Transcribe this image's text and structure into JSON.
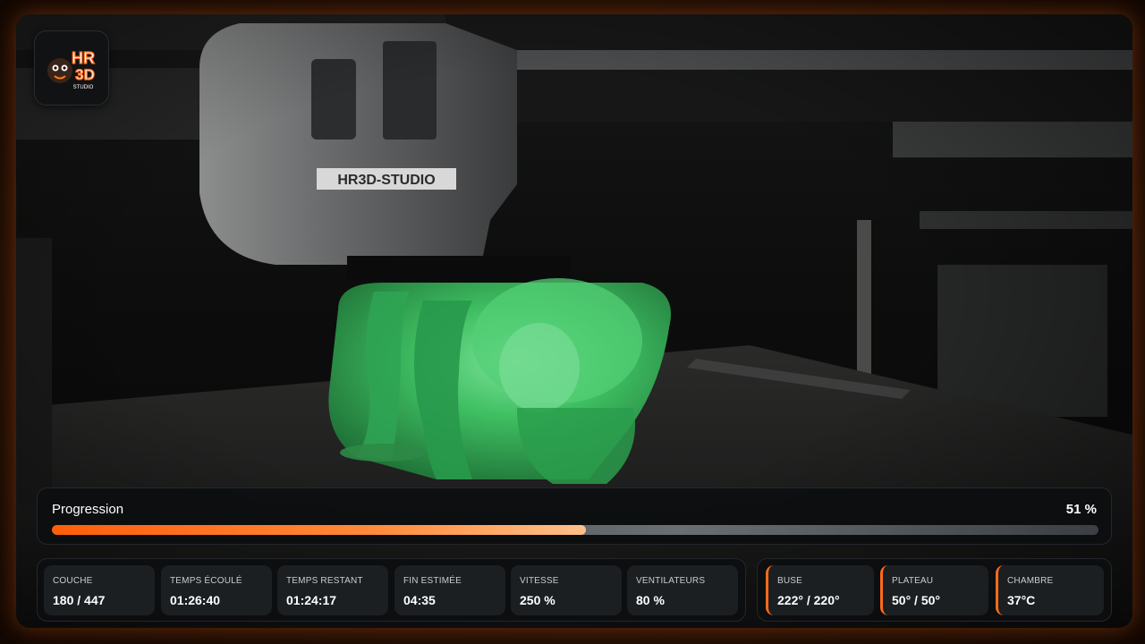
{
  "brand": {
    "logo_text_top": "HR",
    "logo_text_mid": "3D",
    "logo_text_bottom": "STUDIO",
    "printer_label": "HR3D-STUDIO",
    "accent_color": "#ff6a1a"
  },
  "progress": {
    "label": "Progression",
    "value_text": "51 %",
    "fraction": 0.51
  },
  "stats": [
    {
      "label": "COUCHE",
      "value": "180 / 447"
    },
    {
      "label": "TEMPS ÉCOULÉ",
      "value": "01:26:40"
    },
    {
      "label": "TEMPS RESTANT",
      "value": "01:24:17"
    },
    {
      "label": "FIN ESTIMÉE",
      "value": "04:35"
    },
    {
      "label": "VITESSE",
      "value": "250 %"
    },
    {
      "label": "VENTILATEURS",
      "value": "80 %"
    }
  ],
  "temps": [
    {
      "label": "BUSE",
      "value": "222° / 220°"
    },
    {
      "label": "PLATEAU",
      "value": "50° / 50°"
    },
    {
      "label": "CHAMBRE",
      "value": "37°C"
    }
  ],
  "icons": {
    "logo": "hr3d-mascot-logo"
  }
}
